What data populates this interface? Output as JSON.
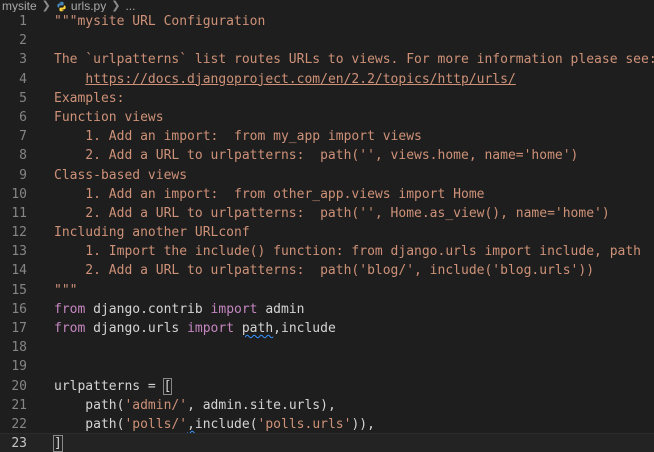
{
  "breadcrumb": {
    "folder": "mysite",
    "file": "urls.py",
    "tail": "..."
  },
  "colors": {
    "background": "#1e1e1e",
    "line_number": "#858585",
    "docstring": "#ce9178",
    "keyword": "#c586c0",
    "identifier": "#d4d4d4",
    "string": "#ce9178",
    "python_icon": "#4b8bbe"
  },
  "editor": {
    "current_line": 23,
    "lines": [
      {
        "n": "1",
        "t": "\"\"\"mysite URL Configuration"
      },
      {
        "n": "2",
        "t": ""
      },
      {
        "n": "3",
        "t": "The `urlpatterns` list routes URLs to views. For more information please see:"
      },
      {
        "n": "4",
        "a": "    ",
        "b": "https://docs.djangoproject.com/en/2.2/topics/http/urls/"
      },
      {
        "n": "5",
        "t": "Examples:"
      },
      {
        "n": "6",
        "t": "Function views"
      },
      {
        "n": "7",
        "t": "    1. Add an import:  from my_app import views"
      },
      {
        "n": "8",
        "t": "    2. Add a URL to urlpatterns:  path('', views.home, name='home')"
      },
      {
        "n": "9",
        "t": "Class-based views"
      },
      {
        "n": "10",
        "t": "    1. Add an import:  from other_app.views import Home"
      },
      {
        "n": "11",
        "t": "    2. Add a URL to urlpatterns:  path('', Home.as_view(), name='home')"
      },
      {
        "n": "12",
        "t": "Including another URLconf"
      },
      {
        "n": "13",
        "t": "    1. Import the include() function: from django.urls import include, path"
      },
      {
        "n": "14",
        "t": "    2. Add a URL to urlpatterns:  path('blog/', include('blog.urls'))"
      },
      {
        "n": "15",
        "t": "\"\"\""
      },
      {
        "n": "16",
        "k1": "from",
        "m1": " django.contrib ",
        "k2": "import",
        "m2": " admin"
      },
      {
        "n": "17",
        "k1": "from",
        "m1": " django.urls ",
        "k2": "import",
        "m2": " ",
        "sq": "path",
        "m3": ",include"
      },
      {
        "n": "18"
      },
      {
        "n": "19"
      },
      {
        "n": "20",
        "a": "urlpatterns = ",
        "br": "["
      },
      {
        "n": "21",
        "a": "    path(",
        "s1": "'admin/'",
        "b": ", admin.site.urls),"
      },
      {
        "n": "22",
        "a": "    path(",
        "s1": "'polls/'",
        "sq": ",",
        "b": "include(",
        "s2": "'polls.urls'",
        "c": ")),"
      },
      {
        "n": "23",
        "br": "]"
      }
    ]
  }
}
